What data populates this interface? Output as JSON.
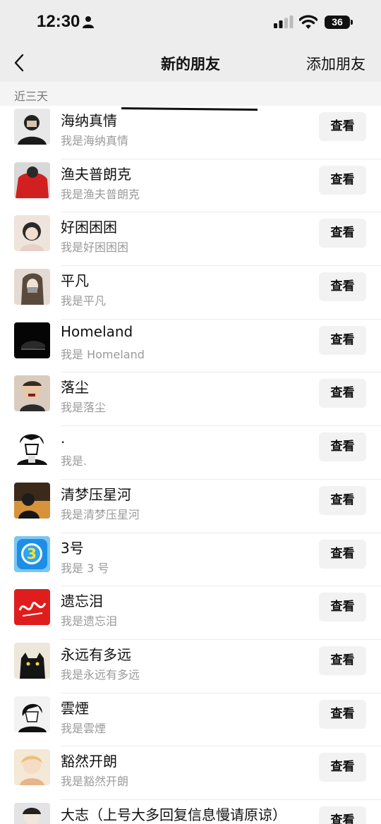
{
  "status_bar": {
    "time": "12:30",
    "battery": "36",
    "icons": [
      "person-icon",
      "signal-icon",
      "wifi-icon",
      "battery-icon"
    ]
  },
  "nav": {
    "back_icon": "chevron-left-icon",
    "title": "新的朋友",
    "action": "添加朋友"
  },
  "section": {
    "label": "近三天"
  },
  "friends": [
    {
      "name": "海纳真情",
      "message": "我是海纳真情",
      "button": "查看",
      "avatar_color": "#3a3a3a"
    },
    {
      "name": "渔夫普朗克",
      "message": "我是渔夫普朗克",
      "button": "查看",
      "avatar_color": "#d0201f"
    },
    {
      "name": "好困困困",
      "message": "我是好困困困",
      "button": "查看",
      "avatar_color": "#e9d6cc"
    },
    {
      "name": "平凡",
      "message": "我是平凡",
      "button": "查看",
      "avatar_color": "#d8cfc8"
    },
    {
      "name": "Homeland",
      "message": "我是 Homeland",
      "button": "查看",
      "avatar_color": "#0d0d0d"
    },
    {
      "name": "落尘",
      "message": "我是落尘",
      "button": "查看",
      "avatar_color": "#c9b7a6"
    },
    {
      "name": ".",
      "message": "我是.",
      "button": "查看",
      "avatar_color": "#f2f2f2"
    },
    {
      "name": "清梦压星河",
      "message": "我是清梦压星河",
      "button": "查看",
      "avatar_color": "#d8a052"
    },
    {
      "name": "3号",
      "message": "我是 3 号",
      "button": "查看",
      "avatar_color": "#1d8ee6"
    },
    {
      "name": "遗忘泪",
      "message": "我是遗忘泪",
      "button": "查看",
      "avatar_color": "#e01d1d"
    },
    {
      "name": "永远有多远",
      "message": "我是永远有多远",
      "button": "查看",
      "avatar_color": "#e9e2d6"
    },
    {
      "name": "雲煙",
      "message": "我是雲煙",
      "button": "查看",
      "avatar_color": "#ececec"
    },
    {
      "name": "豁然开朗",
      "message": "我是豁然开朗",
      "button": "查看",
      "avatar_color": "#f0dcc0"
    },
    {
      "name": "大志（上号大多回复信息慢请原谅）",
      "message": "",
      "button": "查看",
      "avatar_color": "#dcdcdc"
    }
  ]
}
